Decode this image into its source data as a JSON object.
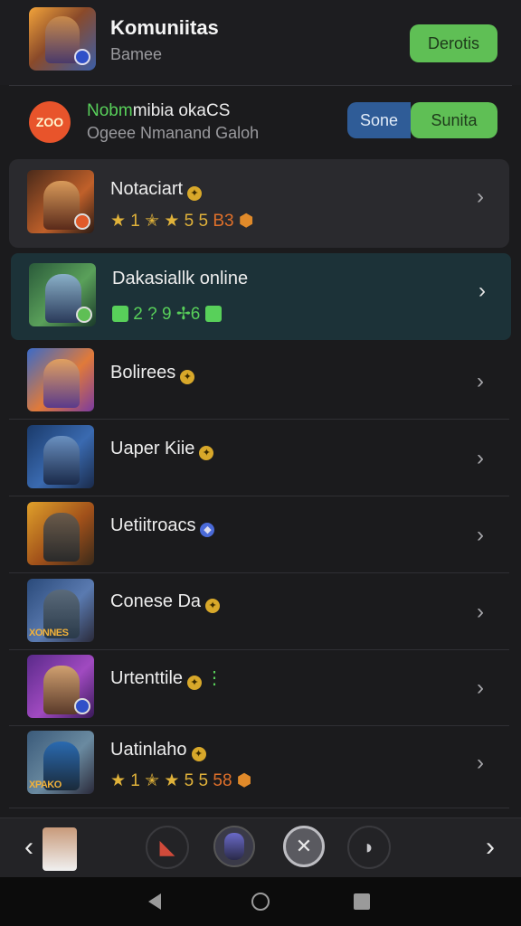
{
  "header": {
    "title": "Komuniitas",
    "subtitle": "Bamee",
    "button": "Derotis"
  },
  "promo": {
    "logo": "ZOO",
    "title_accent": "Nobm",
    "title_rest": "mibia okaCS",
    "subtitle": "Ogeee Nmanand Galoh",
    "seg_left": "Sone",
    "seg_right": "Sunita"
  },
  "list": [
    {
      "title": "Notaciart",
      "meta_stars": "★ 1 ✭ ★ 5 5",
      "meta_tail": "B3",
      "state": "card"
    },
    {
      "title": "Dakasiallk online",
      "meta": "2 ? 9 ✢6",
      "state": "active"
    },
    {
      "title": "Bolirees",
      "state": "plain"
    },
    {
      "title": "Uaper Kiie",
      "state": "plain"
    },
    {
      "title": "Uetiitroacs",
      "state": "plain"
    },
    {
      "title": "Conese Da",
      "state": "plain",
      "thumb_label": "XONNES"
    },
    {
      "title": "Urtenttile",
      "state": "plain"
    },
    {
      "title": "Uatinlaho",
      "meta_stars": "★ 1 ✭ ★ 5 5",
      "meta_tail": "58",
      "state": "plain",
      "thumb_label": "XPAKO"
    }
  ],
  "colors": {
    "accent_green": "#5fbf55",
    "accent_blue": "#2f5c97",
    "background": "#1b1b1d",
    "card": "#2a2a2e",
    "active_row": "#1c3238"
  },
  "icons": {
    "chevron": "chevron-right-icon",
    "bottom": [
      "chevron-left-icon",
      "profile-avatar",
      "megaphone-icon",
      "hero-avatar",
      "close-circle-icon",
      "speaker-icon",
      "chevron-right-icon"
    ]
  }
}
